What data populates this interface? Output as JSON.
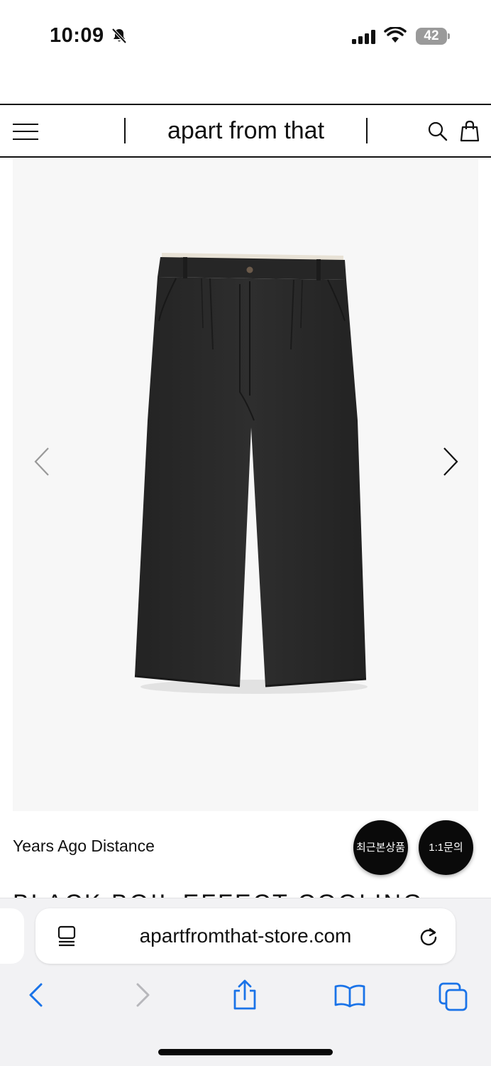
{
  "status_bar": {
    "time": "10:09",
    "battery": "42",
    "icons": [
      "bell-slash-icon",
      "cellular-signal-icon",
      "wifi-icon",
      "battery-icon"
    ]
  },
  "header": {
    "brand": "apart from that",
    "icons": [
      "hamburger-menu-icon",
      "search-icon",
      "shopping-bag-icon"
    ]
  },
  "product": {
    "image_alt": "black wide pleated trousers",
    "brand_name": "Years Ago Distance",
    "title_partial": "BLACK BOIL EFFECT COOLING",
    "icons": [
      "chevron-left-icon",
      "chevron-right-icon"
    ]
  },
  "floating_buttons": {
    "recent": "최근본상품",
    "inquiry": "1:1문의"
  },
  "browser": {
    "url": "apartfromthat-store.com",
    "icons": [
      "page-menu-icon",
      "reload-icon",
      "back-icon",
      "forward-icon",
      "share-icon",
      "bookmarks-icon",
      "tabs-icon"
    ]
  },
  "colors": {
    "text": "#111111",
    "gallery_bg": "#f7f7f7",
    "browser_accent": "#1a73e8",
    "fab_bg": "#0a0a0a"
  }
}
